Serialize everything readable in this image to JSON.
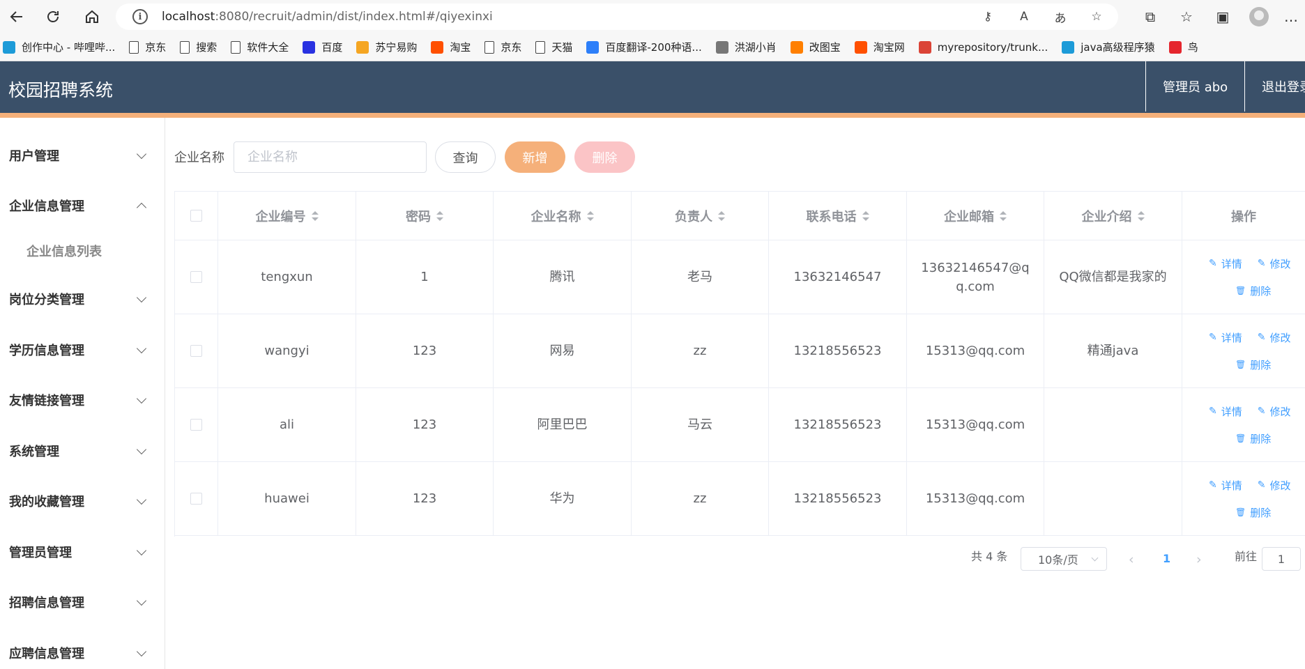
{
  "browser": {
    "url_host": "localhost",
    "url_path": ":8080/recruit/admin/dist/index.html#/qiyexinxi",
    "bookmarks": [
      {
        "label": "创作中心 - 哔哩哔...",
        "icon": "bilibili-icon",
        "color": "#1d9bd8"
      },
      {
        "label": "京东",
        "icon": "page-icon"
      },
      {
        "label": "搜索",
        "icon": "page-icon"
      },
      {
        "label": "软件大全",
        "icon": "page-icon"
      },
      {
        "label": "百度",
        "icon": "baidu-icon",
        "color": "#2932e1"
      },
      {
        "label": "苏宁易购",
        "icon": "suning-icon",
        "color": "#f5a623"
      },
      {
        "label": "淘宝",
        "icon": "taobao-icon",
        "color": "#ff5000"
      },
      {
        "label": "京东",
        "icon": "page-icon"
      },
      {
        "label": "天猫",
        "icon": "page-icon"
      },
      {
        "label": "百度翻译-200种语...",
        "icon": "baidu-translate-icon",
        "color": "#2d7ff9"
      },
      {
        "label": "洪湖小肖",
        "icon": "bird-icon",
        "color": "#777"
      },
      {
        "label": "改图宝",
        "icon": "gaitubao-icon",
        "color": "#ff7f00"
      },
      {
        "label": "淘宝网",
        "icon": "taobao-icon",
        "color": "#ff5000"
      },
      {
        "label": "myrepository/trunk...",
        "icon": "chrome-icon",
        "color": "#db4437"
      },
      {
        "label": "java高级程序猿",
        "icon": "bilibili-icon",
        "color": "#1d9bd8"
      },
      {
        "label": "鸟",
        "icon": "bird-red-icon",
        "color": "#e5262e"
      }
    ]
  },
  "header": {
    "title": "校园招聘系统",
    "admin": "管理员 abo",
    "logout": "退出登录"
  },
  "sidebar": {
    "items": [
      {
        "label": "用户管理",
        "expanded": false
      },
      {
        "label": "企业信息管理",
        "expanded": true,
        "children": [
          "企业信息列表"
        ]
      },
      {
        "label": "岗位分类管理",
        "expanded": false
      },
      {
        "label": "学历信息管理",
        "expanded": false
      },
      {
        "label": "友情链接管理",
        "expanded": false
      },
      {
        "label": "系统管理",
        "expanded": false
      },
      {
        "label": "我的收藏管理",
        "expanded": false
      },
      {
        "label": "管理员管理",
        "expanded": false
      },
      {
        "label": "招聘信息管理",
        "expanded": false
      },
      {
        "label": "应聘信息管理",
        "expanded": false
      }
    ]
  },
  "search": {
    "label": "企业名称",
    "placeholder": "企业名称",
    "query_label": "查询",
    "add_label": "新增",
    "delete_label": "删除"
  },
  "table": {
    "columns": [
      "企业编号",
      "密码",
      "企业名称",
      "负责人",
      "联系电话",
      "企业邮箱",
      "企业介绍",
      "操作"
    ],
    "rows": [
      [
        "tengxun",
        "1",
        "腾讯",
        "老马",
        "13632146547",
        "13632146547@qq.com",
        "QQ微信都是我家的"
      ],
      [
        "wangyi",
        "123",
        "网易",
        "zz",
        "13218556523",
        "15313@qq.com",
        "精通java"
      ],
      [
        "ali",
        "123",
        "阿里巴巴",
        "马云",
        "13218556523",
        "15313@qq.com",
        ""
      ],
      [
        "huawei",
        "123",
        "华为",
        "zz",
        "13218556523",
        "15313@qq.com",
        ""
      ]
    ],
    "actions": {
      "detail": "详情",
      "edit": "修改",
      "delete": "删除"
    }
  },
  "pagination": {
    "total": "共 4 条",
    "page_size": "10条/页",
    "current_page": "1",
    "goto_label": "前往",
    "goto_value": "1"
  }
}
